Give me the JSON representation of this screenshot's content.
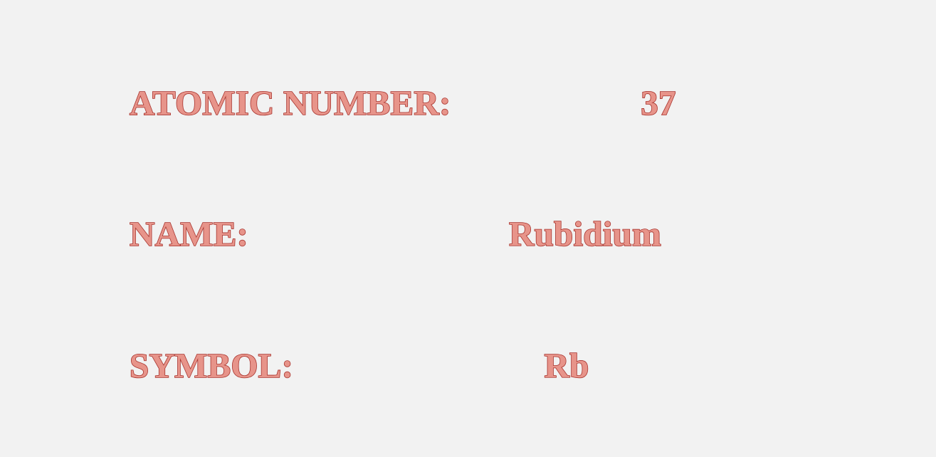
{
  "element": {
    "atomic_number_label": "ATOMIC NUMBER:",
    "atomic_number": "37",
    "name_label": "NAME:",
    "name": "Rubidium",
    "symbol_label": "SYMBOL:",
    "symbol": "Rb"
  },
  "colors": {
    "background": "#f2f2f2",
    "text_fill": "#e7948a",
    "text_outline": "#a8322c"
  }
}
